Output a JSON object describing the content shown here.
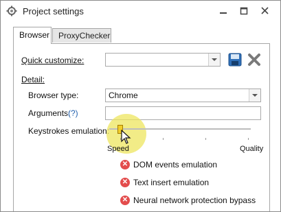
{
  "window": {
    "title": "Project settings"
  },
  "tabs": [
    {
      "label": "Browser"
    },
    {
      "label": "ProxyChecker"
    }
  ],
  "browser_tab": {
    "quick_customize_label": "Quick customize:",
    "quick_customize_value": "",
    "detail_label": "Detail:",
    "browser_type_label": "Browser type:",
    "browser_type_value": "Chrome",
    "arguments_label": "Arguments:",
    "arguments_help": "(?)",
    "arguments_value": "",
    "keystrokes_label": "Keystrokes emulation:",
    "slider": {
      "min_label": "Speed",
      "max_label": "Quality",
      "level": 0
    },
    "options": [
      {
        "label": "DOM events emulation",
        "icon": "x-circle-icon",
        "color": "#e34c4c"
      },
      {
        "label": "Text insert emulation",
        "icon": "x-circle-icon",
        "color": "#e34c4c"
      },
      {
        "label": "Neural network protection bypass",
        "icon": "x-circle-icon",
        "color": "#e34c4c"
      }
    ]
  },
  "icons": {
    "title": "gear-icon",
    "save": "save-icon",
    "delete": "close-icon"
  }
}
